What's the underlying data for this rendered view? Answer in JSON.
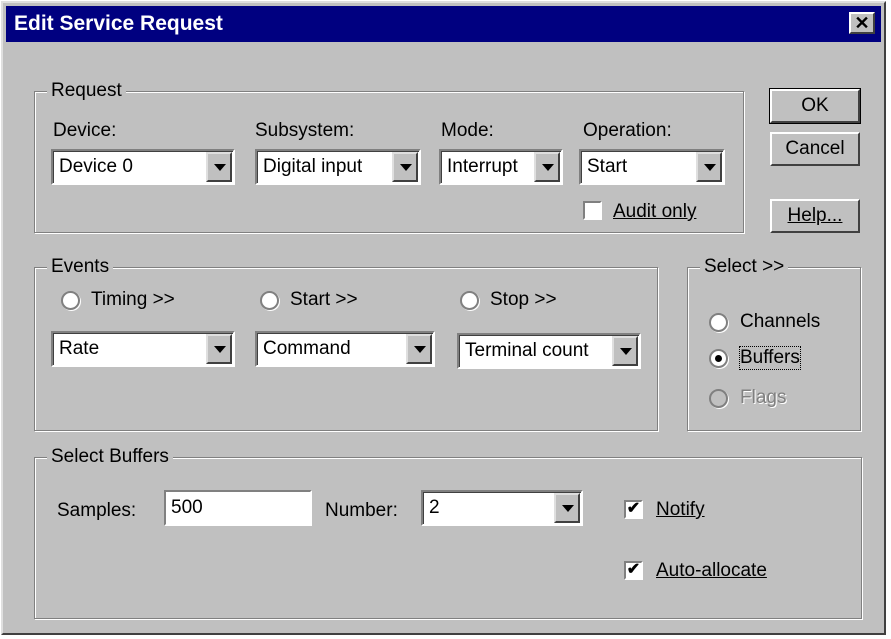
{
  "window": {
    "title": "Edit Service Request",
    "close_glyph": "✕"
  },
  "buttons": {
    "ok": "OK",
    "cancel": "Cancel",
    "help": "Help..."
  },
  "request": {
    "legend": "Request",
    "device_label": "Device:",
    "device_value": "Device 0",
    "subsystem_label": "Subsystem:",
    "subsystem_value": "Digital input",
    "mode_label": "Mode:",
    "mode_value": "Interrupt",
    "operation_label": "Operation:",
    "operation_value": "Start",
    "audit_label": "Audit only",
    "audit_checked": false
  },
  "events": {
    "legend": "Events",
    "timing_label": "Timing >>",
    "timing_value": "Rate",
    "start_label": "Start >>",
    "start_value": "Command",
    "stop_label": "Stop >>",
    "stop_value": "Terminal count"
  },
  "select": {
    "legend": "Select >>",
    "channels": "Channels",
    "buffers": "Buffers",
    "flags": "Flags",
    "selected": "buffers"
  },
  "select_buffers": {
    "legend": "Select Buffers",
    "samples_label": "Samples:",
    "samples_value": "500",
    "number_label": "Number:",
    "number_value": "2",
    "notify_label": "Notify",
    "notify_checked": true,
    "autoalloc_label": "Auto-allocate",
    "autoalloc_checked": true
  },
  "icons": {
    "dropdown": "dropdown-arrow-icon",
    "check": "✔"
  }
}
